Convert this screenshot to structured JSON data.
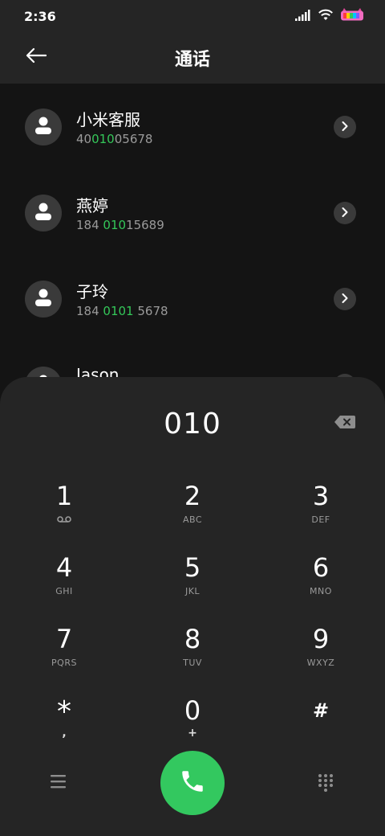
{
  "status_bar": {
    "time": "2:36"
  },
  "header": {
    "title": "通话"
  },
  "contacts": [
    {
      "name": "小米客服",
      "number_parts": [
        "40",
        "010",
        "05678"
      ]
    },
    {
      "name": "燕婷",
      "number_parts": [
        "184 ",
        "010",
        "15689"
      ]
    },
    {
      "name": "子玲",
      "number_parts": [
        "184 ",
        "0101",
        " 5678"
      ]
    },
    {
      "name": "Jason",
      "number_parts": [
        "",
        "",
        ""
      ]
    }
  ],
  "dialpad": {
    "value": "010",
    "keys": [
      {
        "digit": "1",
        "letters": ""
      },
      {
        "digit": "2",
        "letters": "ABC"
      },
      {
        "digit": "3",
        "letters": "DEF"
      },
      {
        "digit": "4",
        "letters": "GHI"
      },
      {
        "digit": "5",
        "letters": "JKL"
      },
      {
        "digit": "6",
        "letters": "MNO"
      },
      {
        "digit": "7",
        "letters": "PQRS"
      },
      {
        "digit": "8",
        "letters": "TUV"
      },
      {
        "digit": "9",
        "letters": "WXYZ"
      },
      {
        "digit": "*",
        "letters": ","
      },
      {
        "digit": "0",
        "letters": "+"
      },
      {
        "digit": "#",
        "letters": ""
      }
    ]
  },
  "colors": {
    "accent": "#34c759",
    "call_button": "#33c85f",
    "background": "#141414",
    "panel": "#252525"
  },
  "icons": {
    "back": "back-arrow-icon",
    "voicemail": "voicemail-icon",
    "backspace": "backspace-icon",
    "menu": "menu-icon",
    "call": "phone-icon",
    "keypad": "keypad-icon"
  }
}
